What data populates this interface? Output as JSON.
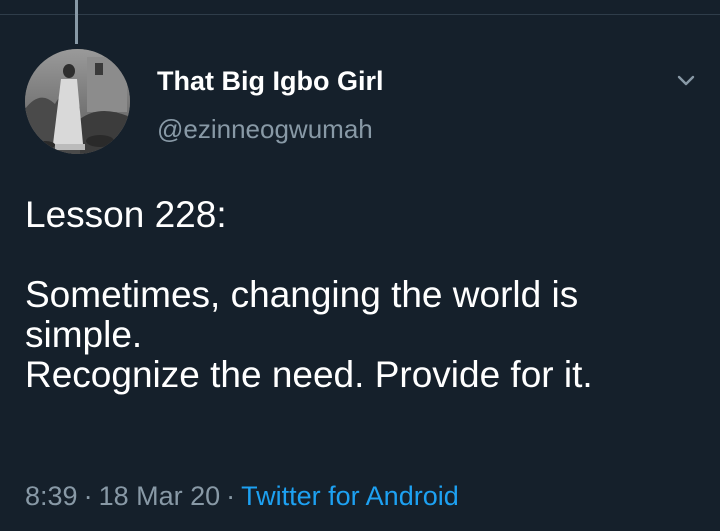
{
  "author": {
    "display_name": "That Big Igbo Girl",
    "handle": "@ezinneogwumah"
  },
  "tweet": {
    "lines": [
      "Lesson 228:",
      "",
      "Sometimes, changing the world is",
      "simple.",
      "Recognize the need. Provide for it."
    ]
  },
  "meta": {
    "time": "8:39",
    "separator": "·",
    "date": "18 Mar 20",
    "source": "Twitter for Android"
  },
  "icons": {
    "caret": "chevron-down-icon"
  },
  "colors": {
    "background": "#15202b",
    "text": "#ffffff",
    "secondary_text": "#8899a6",
    "link": "#1da1f2"
  }
}
